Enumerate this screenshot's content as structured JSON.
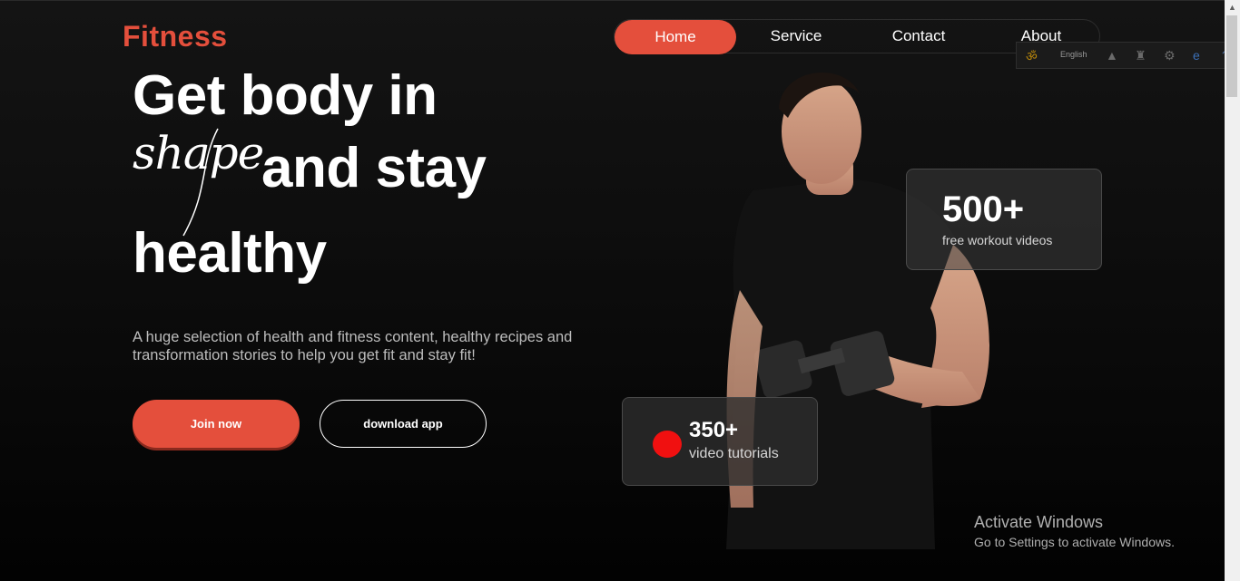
{
  "brand": {
    "logo": "Fitness",
    "accent": "#e44f3c"
  },
  "nav": {
    "items": [
      "Home",
      "Service",
      "Contact",
      "About"
    ],
    "active": "Home"
  },
  "hero": {
    "line1": "Get body in",
    "script_word": "shape",
    "line2": "and stay",
    "line3": "healthy",
    "description": "A huge selection of health and fitness content, healthy recipes and transformation stories to help you get fit and stay fit!"
  },
  "buttons": {
    "join": "Join now",
    "download": "download app"
  },
  "stats": [
    {
      "number": "500+",
      "label": "free workout videos"
    },
    {
      "number": "350+",
      "label": "video tutorials"
    }
  ],
  "toolbar": {
    "language": "English"
  },
  "watermark": {
    "title": "Activate Windows",
    "subtitle": "Go to Settings to activate Windows."
  }
}
